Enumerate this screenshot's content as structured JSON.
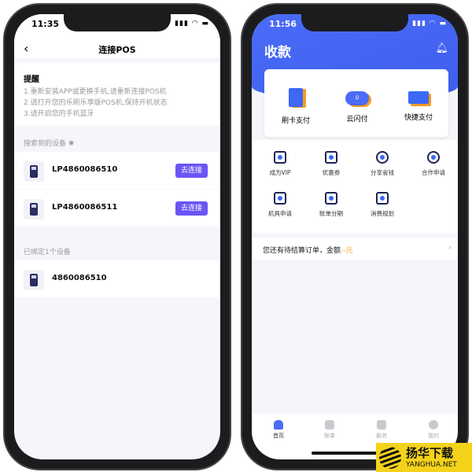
{
  "left_phone": {
    "status_time": "11:35",
    "nav": {
      "back_icon": "chevron-left-icon",
      "title": "连接POS"
    },
    "reminder": {
      "title": "提醒",
      "lines": [
        "1.重新安装APP或更换手机,请重新连接POS机",
        "2.请打开您的乐刷乐享版POS机,保持开机状态",
        "3.请开启您的手机蓝牙"
      ]
    },
    "search_section": {
      "label": "搜索到的设备",
      "loading_icon": "spinner-icon"
    },
    "found_devices": [
      {
        "name": "LP4860086510",
        "button": "去连接"
      },
      {
        "name": "LP4860086511",
        "button": "去连接"
      }
    ],
    "bound_section": {
      "label": "已绑定1个设备"
    },
    "bound_devices": [
      {
        "name": "4860086510"
      }
    ]
  },
  "right_phone": {
    "status_time": "11:56",
    "header": {
      "title": "收款",
      "bell_icon": "bell-icon"
    },
    "pay_methods": [
      {
        "label": "刷卡支付",
        "icon": "pos-card-icon"
      },
      {
        "label": "云闪付",
        "icon": "quick-cloud-icon"
      },
      {
        "label": "快捷支付",
        "icon": "bank-card-icon"
      }
    ],
    "grid": [
      {
        "label": "成为VIP"
      },
      {
        "label": "优惠券"
      },
      {
        "label": "分享省钱"
      },
      {
        "label": "合作申请"
      },
      {
        "label": "机具申请"
      },
      {
        "label": "账单分期"
      },
      {
        "label": "消费规划"
      }
    ],
    "pending": {
      "text": "您还有待结算订单，金额",
      "amount": "--元"
    },
    "tabs": [
      {
        "label": "首页",
        "active": true
      },
      {
        "label": "账单"
      },
      {
        "label": "服务"
      },
      {
        "label": "我的"
      }
    ]
  },
  "watermark": {
    "cn": "扬华下载",
    "en": "YANGHUA.NET"
  },
  "colors": {
    "primary_blue": "#4a6cf7",
    "button_purple": "#6a55f5",
    "orange": "#f5a623"
  }
}
